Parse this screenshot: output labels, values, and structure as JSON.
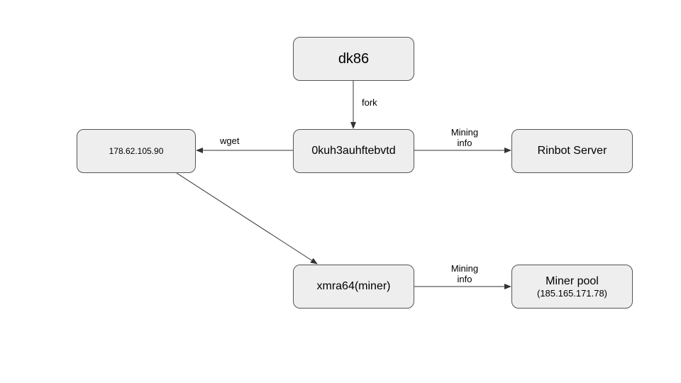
{
  "nodes": {
    "dk86": {
      "label": "dk86"
    },
    "ip_server": {
      "label": "178.62.105.90"
    },
    "payload": {
      "label": "0kuh3auhftebvtd"
    },
    "rinbot": {
      "label": "Rinbot Server"
    },
    "miner": {
      "label": "xmra64(miner)"
    },
    "pool": {
      "label_line1": "Miner pool",
      "label_line2": "(185.165.171.78)"
    }
  },
  "edges": {
    "fork": {
      "label": "fork"
    },
    "wget": {
      "label": "wget"
    },
    "mining_info_1": {
      "label_line1": "Mining",
      "label_line2": "info"
    },
    "download": {
      "label": ""
    },
    "mining_info_2": {
      "label_line1": "Mining",
      "label_line2": "info"
    }
  },
  "chart_data": {
    "type": "diagram",
    "title": "",
    "nodes": [
      {
        "id": "dk86",
        "label": "dk86"
      },
      {
        "id": "ip_server",
        "label": "178.62.105.90"
      },
      {
        "id": "payload",
        "label": "0kuh3auhftebvtd"
      },
      {
        "id": "rinbot",
        "label": "Rinbot Server"
      },
      {
        "id": "miner",
        "label": "xmra64(miner)"
      },
      {
        "id": "pool",
        "label": "Miner pool (185.165.171.78)"
      }
    ],
    "edges": [
      {
        "from": "dk86",
        "to": "payload",
        "label": "fork",
        "directed": true
      },
      {
        "from": "payload",
        "to": "ip_server",
        "label": "wget",
        "directed": true
      },
      {
        "from": "payload",
        "to": "rinbot",
        "label": "Mining info",
        "directed": true
      },
      {
        "from": "ip_server",
        "to": "miner",
        "label": "",
        "directed": true
      },
      {
        "from": "miner",
        "to": "pool",
        "label": "Mining info",
        "directed": true
      }
    ]
  }
}
